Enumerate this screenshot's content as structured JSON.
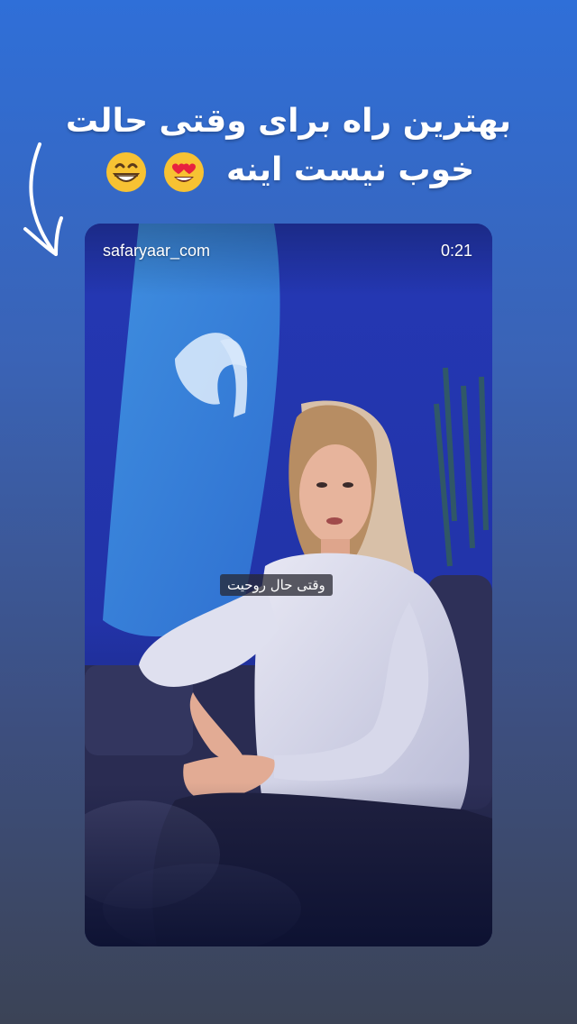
{
  "headline": {
    "line1": "بهترین راه برای وقتی حالت",
    "line2": "خوب نیست اینه",
    "emojis": [
      "grinning-face-with-smiling-eyes",
      "smiling-face-with-heart-eyes"
    ]
  },
  "video": {
    "username": "safaryaar_com",
    "time": "0:21",
    "subtitle": "وقتی حال روحیت"
  },
  "colors": {
    "bg_top": "#2f6fd8",
    "bg_bottom": "#3b4356",
    "emoji_yellow": "#f7c233"
  }
}
